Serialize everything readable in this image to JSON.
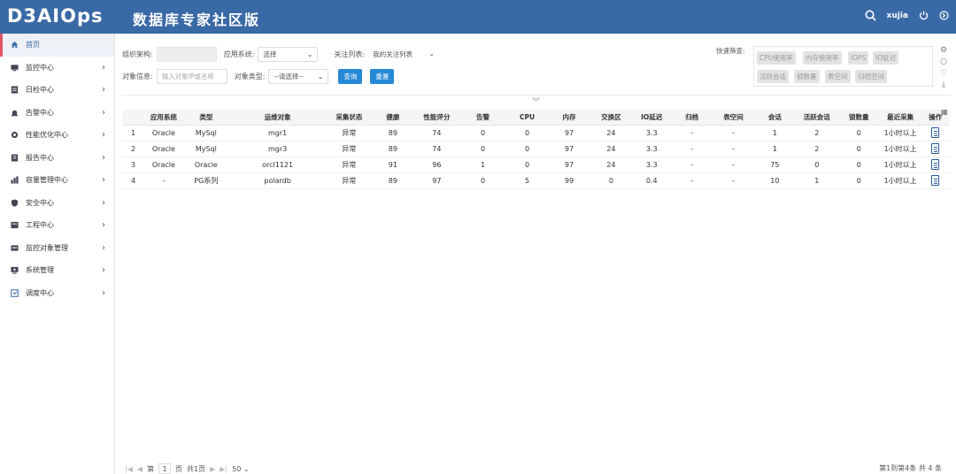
{
  "header": {
    "logo": "D3AIOps",
    "title": "数据库专家社区版",
    "username": "xujia"
  },
  "sidebar": {
    "items": [
      {
        "label": "首页",
        "icon": "home-icon",
        "active": true,
        "chevron": ""
      },
      {
        "label": "监控中心",
        "icon": "monitor-icon",
        "chevron": "›"
      },
      {
        "label": "日检中心",
        "icon": "daily-check-icon",
        "chevron": "›"
      },
      {
        "label": "告警中心",
        "icon": "alarm-icon",
        "chevron": "›"
      },
      {
        "label": "性能优化中心",
        "icon": "performance-icon",
        "chevron": "›"
      },
      {
        "label": "报告中心",
        "icon": "report-icon",
        "chevron": "›"
      },
      {
        "label": "容量管理中心",
        "icon": "capacity-icon",
        "chevron": "›"
      },
      {
        "label": "安全中心",
        "icon": "security-icon",
        "chevron": "›"
      },
      {
        "label": "工程中心",
        "icon": "engineering-icon",
        "chevron": "›"
      },
      {
        "label": "监控对象管理",
        "icon": "object-manage-icon",
        "chevron": "›"
      },
      {
        "label": "系统管理",
        "icon": "system-icon",
        "chevron": "›"
      },
      {
        "label": "调度中心",
        "icon": "schedule-icon",
        "chevron": "›"
      }
    ]
  },
  "filters": {
    "org_label": "组织架构:",
    "app_label": "应用系统:",
    "app_value": "选择",
    "focus_label": "关注列表:",
    "focus_value": "我的关注列表",
    "object_label": "对象信息:",
    "object_placeholder": "输入对象IP或名称",
    "type_label": "对象类型:",
    "type_value": "--请选择--",
    "query_button": "查询",
    "reset_button": "重置"
  },
  "quick_filter": {
    "label": "快速筛查:",
    "tags": [
      "CPU使用率",
      "内存使用率",
      "IOPS",
      "IO延迟",
      "活跃会话",
      "锁数量",
      "表空间",
      "归档空间"
    ]
  },
  "table": {
    "columns": [
      "",
      "应用系统",
      "类型",
      "运维对象",
      "采集状态",
      "健康",
      "性能评分",
      "告警",
      "CPU",
      "内存",
      "交换区",
      "IO延迟",
      "归档",
      "表空间",
      "会话",
      "活跃会话",
      "锁数量",
      "最近采集",
      "操作"
    ],
    "rows": [
      {
        "idx": "1",
        "app": "Oracle",
        "type": "MySql",
        "object": "mgr1",
        "status": "异常",
        "health": "89",
        "score": "74",
        "alarm": "0",
        "cpu": "0",
        "mem": "97",
        "swap": "24",
        "io": "3.3",
        "archive": "-",
        "tablespace": "-",
        "sessions": "1",
        "active": "2",
        "locks": "0",
        "last": "1小时以上"
      },
      {
        "idx": "2",
        "app": "Oracle",
        "type": "MySql",
        "object": "mgr3",
        "status": "异常",
        "health": "89",
        "score": "74",
        "alarm": "0",
        "cpu": "0",
        "mem": "97",
        "swap": "24",
        "io": "3.3",
        "archive": "-",
        "tablespace": "-",
        "sessions": "1",
        "active": "2",
        "locks": "0",
        "last": "1小时以上"
      },
      {
        "idx": "3",
        "app": "Oracle",
        "type": "Oracle",
        "object": "orcl1121",
        "status": "异常",
        "health": "91",
        "score": "96",
        "alarm": "1",
        "cpu": "0",
        "mem": "97",
        "swap": "24",
        "io": "3.3",
        "archive": "-",
        "tablespace": "-",
        "sessions": "75",
        "active": "0",
        "locks": "0",
        "last": "1小时以上"
      },
      {
        "idx": "4",
        "app": "-",
        "type": "PG系列",
        "object": "polardb",
        "status": "异常",
        "health": "89",
        "score": "97",
        "alarm": "0",
        "cpu": "5",
        "mem": "99",
        "swap": "0",
        "io": "0.4",
        "archive": "-",
        "tablespace": "-",
        "sessions": "10",
        "active": "1",
        "locks": "0",
        "last": "1小时以上"
      }
    ]
  },
  "pager": {
    "first": "|◀",
    "prev": "◀",
    "page_prefix": "第",
    "page": "1",
    "page_suffix": "页",
    "total_pages": "共1页",
    "next": "▶",
    "last": "▶|",
    "page_size": "50",
    "summary": "第1到第4条  共 4 条"
  },
  "colors": {
    "header_bg": "#3a6aa6",
    "accent": "#2589d6",
    "active_marker": "#e05563",
    "danger": "#e02c2c",
    "warning": "#e0a030",
    "success": "#2aa842"
  }
}
